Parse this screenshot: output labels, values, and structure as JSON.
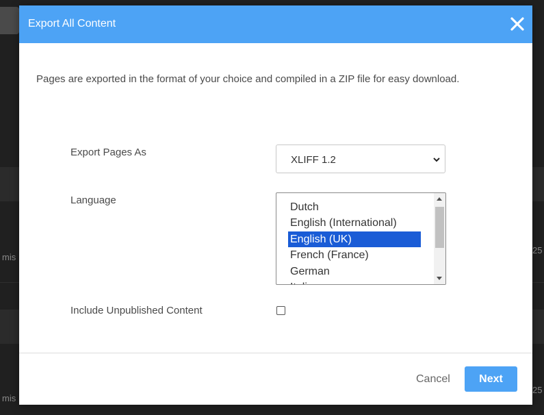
{
  "background": {
    "left_text_1": "mis",
    "left_text_2": "mis",
    "right_text_1": "25",
    "right_text_2": "25"
  },
  "modal": {
    "title": "Export All Content",
    "close_icon": "close-icon",
    "description": "Pages are exported in the format of your choice and compiled in a ZIP file for easy download.",
    "export_label": "Export Pages As",
    "export_value": "XLIFF 1.2",
    "language_label": "Language",
    "languages": [
      {
        "label": "Dutch",
        "selected": false
      },
      {
        "label": "English (International)",
        "selected": false
      },
      {
        "label": "English (UK)",
        "selected": true
      },
      {
        "label": "French (France)",
        "selected": false
      },
      {
        "label": "German",
        "selected": false
      },
      {
        "label": "Italian",
        "selected": false
      }
    ],
    "unpublished_label": "Include Unpublished Content",
    "unpublished_checked": false,
    "cancel_label": "Cancel",
    "next_label": "Next"
  },
  "colors": {
    "accent": "#4da3f5",
    "selection": "#1a5cd6"
  }
}
